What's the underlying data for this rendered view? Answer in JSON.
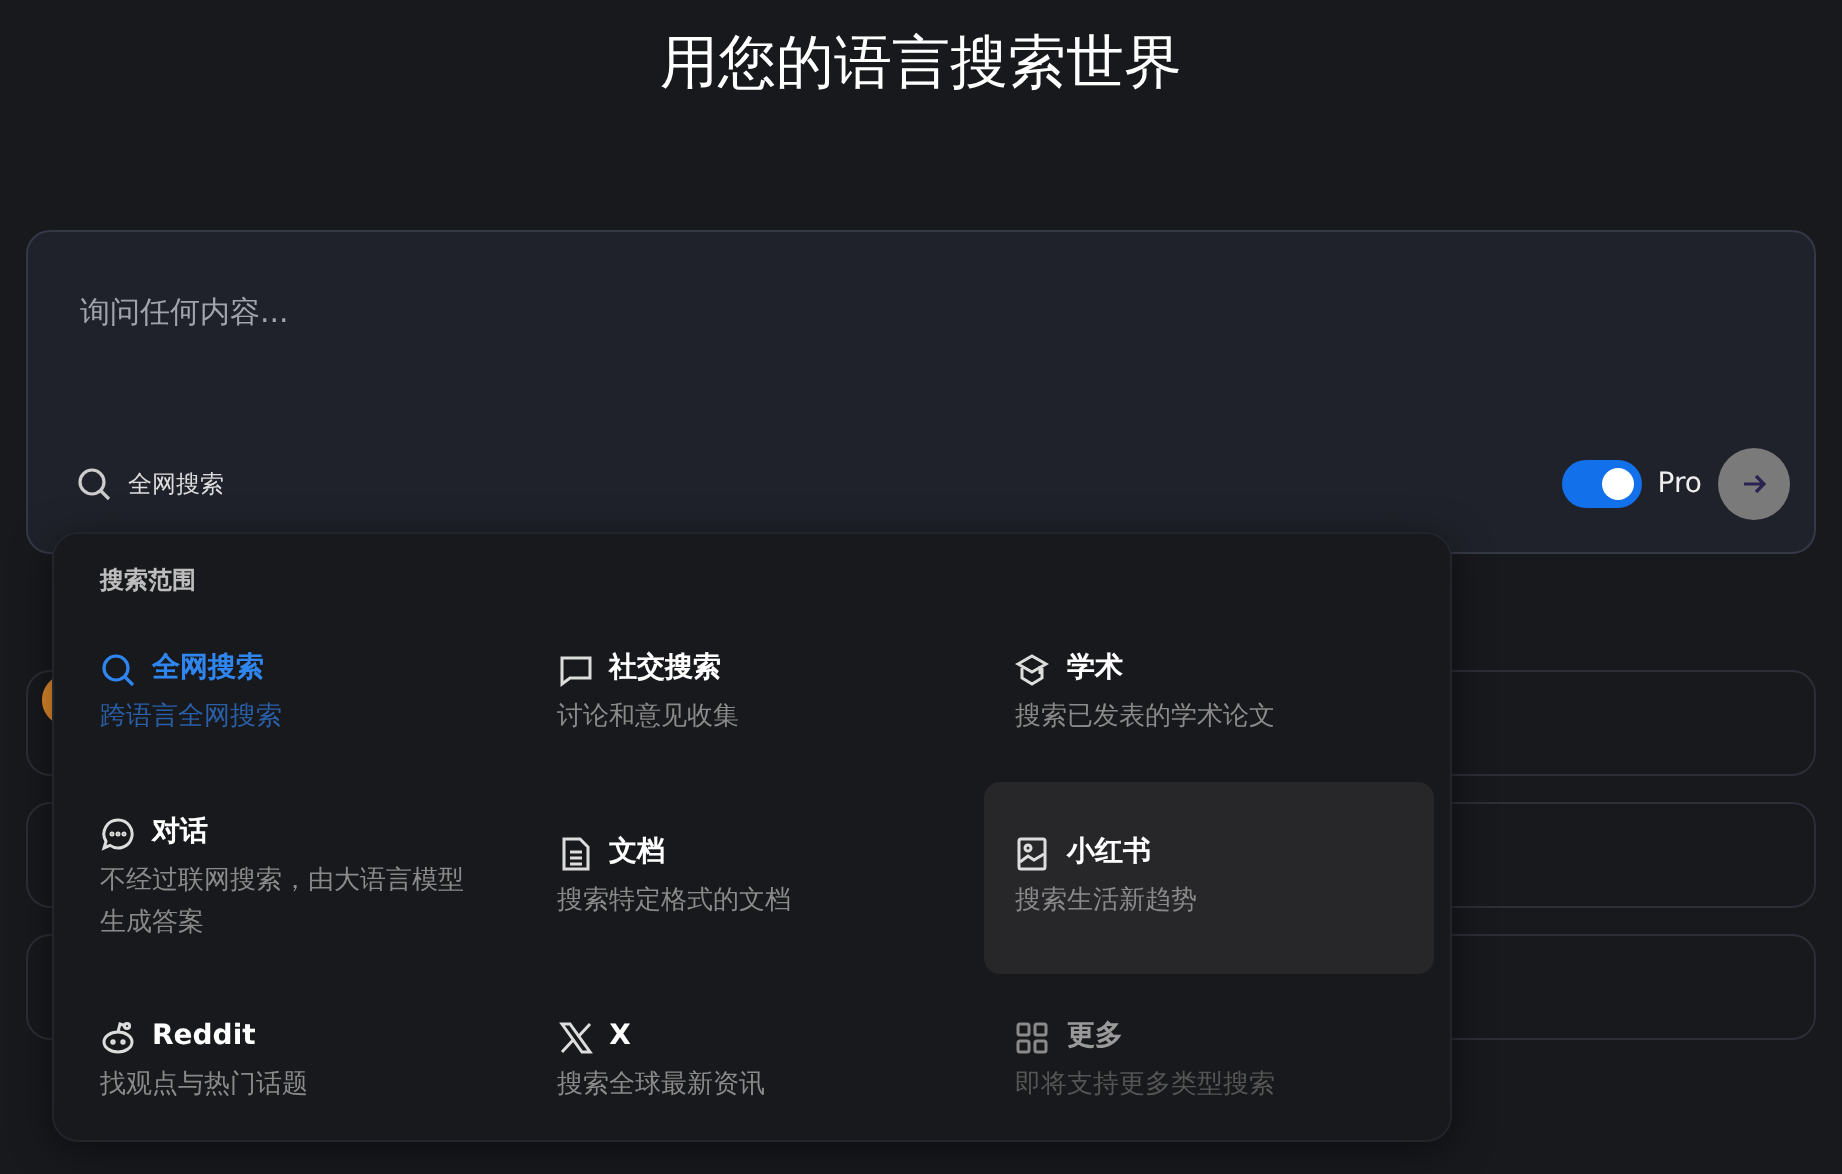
{
  "heading": "用您的语言搜索世界",
  "search": {
    "placeholder": "询问任何内容...",
    "scope_label": "全网搜索",
    "pro": {
      "label": "Pro",
      "on": true
    }
  },
  "scope_menu": {
    "title": "搜索范围",
    "items": [
      {
        "title": "全网搜索",
        "description": "跨语言全网搜索",
        "selected": true,
        "hovered": false,
        "disabled": false
      },
      {
        "title": "社交搜索",
        "description": "讨论和意见收集",
        "selected": false,
        "hovered": false,
        "disabled": false
      },
      {
        "title": "学术",
        "description": "搜索已发表的学术论文",
        "selected": false,
        "hovered": false,
        "disabled": false
      },
      {
        "title": "对话",
        "description": "不经过联网搜索，由大语言模型生成答案",
        "selected": false,
        "hovered": false,
        "disabled": false
      },
      {
        "title": "文档",
        "description": "搜索特定格式的文档",
        "selected": false,
        "hovered": false,
        "disabled": false
      },
      {
        "title": "小红书",
        "description": "搜索生活新趋势",
        "selected": false,
        "hovered": true,
        "disabled": false
      },
      {
        "title": "Reddit",
        "description": "找观点与热门话题",
        "selected": false,
        "hovered": false,
        "disabled": false
      },
      {
        "title": "X",
        "description": "搜索全球最新资讯",
        "selected": false,
        "hovered": false,
        "disabled": false
      },
      {
        "title": "更多",
        "description": "即将支持更多类型搜索",
        "selected": false,
        "hovered": false,
        "disabled": true
      }
    ]
  }
}
